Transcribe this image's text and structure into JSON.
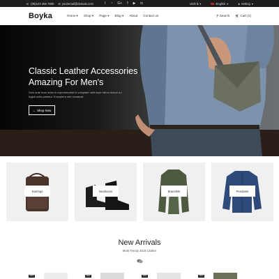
{
  "topbar": {
    "phone": "(08)123 456 7890",
    "email": "youremail@domain.com",
    "social_icons": [
      "twitter-icon",
      "rss-icon",
      "google-plus-icon",
      "facebook-icon",
      "youtube-icon",
      "instagram-icon"
    ],
    "currency": "USD $",
    "language": "English",
    "account": "Setting"
  },
  "header": {
    "logo": "Boyka",
    "nav": [
      "Home",
      "Shop",
      "Page",
      "Blog",
      "About",
      "Contact us"
    ],
    "search": "Search",
    "cart": "Cart (2)"
  },
  "hero": {
    "title_line1": "Classic Leather Accessories",
    "title_line2": "Amazing For Men's",
    "text": "Duis aute irure dolor in reprehenderit in voluptate velit esse cillum dolore eu fugiat nulla pariatur. Excepteur sint occaecat",
    "button": "Shop Now"
  },
  "categories": [
    {
      "label": "Earrings",
      "icon": "backpack-icon"
    },
    {
      "label": "Necklaces",
      "icon": "boots-icon"
    },
    {
      "label": "Bracelets",
      "icon": "jacket-icon"
    },
    {
      "label": "Pendants",
      "icon": "shirt-icon"
    }
  ],
  "arrivals": {
    "title": "New Arrivals",
    "subtitle": "Most Trendy 2018 Clother",
    "badge": "NEW"
  },
  "colors": {
    "hero_dark": "#0a0a0a",
    "topbar": "#1c1c1c",
    "category_bg": "#f0f0f0"
  }
}
